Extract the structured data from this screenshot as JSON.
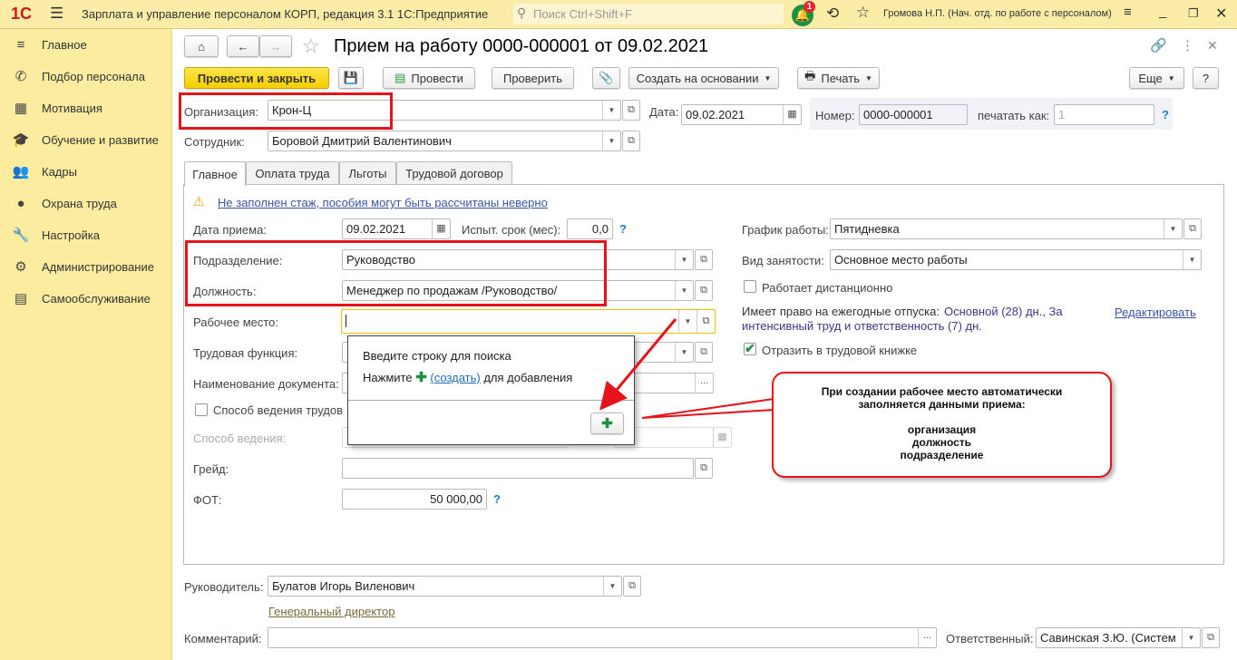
{
  "app": {
    "logo": "1С",
    "title": "Зарплата и управление персоналом КОРП, редакция 3.1 1С:Предприятие",
    "search_placeholder": "Поиск Ctrl+Shift+F",
    "notifications_count": "1",
    "user": "Громова Н.П. (Нач. отд. по работе с персоналом)"
  },
  "sidebar": {
    "items": [
      {
        "label": "Главное",
        "icon": "menu-icon"
      },
      {
        "label": "Подбор персонала",
        "icon": "phone-icon"
      },
      {
        "label": "Мотивация",
        "icon": "gift-icon"
      },
      {
        "label": "Обучение и развитие",
        "icon": "graduation-cap-icon"
      },
      {
        "label": "Кадры",
        "icon": "users-icon"
      },
      {
        "label": "Охрана труда",
        "icon": "helmet-icon"
      },
      {
        "label": "Настройка",
        "icon": "wrench-icon"
      },
      {
        "label": "Администрирование",
        "icon": "gear-icon"
      },
      {
        "label": "Самообслуживание",
        "icon": "id-card-icon"
      }
    ]
  },
  "doc": {
    "title": "Прием на работу 0000-000001 от 09.02.2021"
  },
  "toolbar": {
    "post_close": "Провести и закрыть",
    "post": "Провести",
    "check": "Проверить",
    "create_based": "Создать на основании",
    "print": "Печать",
    "more": "Еще",
    "help": "?"
  },
  "header": {
    "org_label": "Организация:",
    "org_value": "Крон-Ц",
    "date_label": "Дата:",
    "date_value": "09.02.2021",
    "number_label": "Номер:",
    "number_value": "0000-000001",
    "print_as_label": "печатать как:",
    "print_as_value": "1",
    "employee_label": "Сотрудник:",
    "employee_value": "Боровой Дмитрий Валентинович"
  },
  "tabs": [
    "Главное",
    "Оплата труда",
    "Льготы",
    "Трудовой договор"
  ],
  "main": {
    "warning": "Не заполнен стаж, пособия могут быть рассчитаны неверно",
    "hire_date_label": "Дата приема:",
    "hire_date_value": "09.02.2021",
    "probation_label": "Испыт. срок (мес):",
    "probation_value": "0,0",
    "department_label": "Подразделение:",
    "department_value": "Руководство",
    "position_label": "Должность:",
    "position_value": "Менеджер по продажам /Руководство/",
    "workplace_label": "Рабочее место:",
    "workplace_value": "",
    "labor_function_label": "Трудовая функция:",
    "doc_name_label": "Наименование документа:",
    "method_checkbox_label": "Способ ведения трудов",
    "method_label": "Способ ведения:",
    "grade_label": "Грейд:",
    "grade_value": "",
    "fot_label": "ФОТ:",
    "fot_value": "50 000,00",
    "schedule_label": "График работы:",
    "schedule_value": "Пятидневка",
    "employment_label": "Вид занятости:",
    "employment_value": "Основное место работы",
    "remote_label": "Работает дистанционно",
    "remote_checked": false,
    "vacation_label": "Имеет право на ежегодные отпуска:",
    "vacation_value1": "Основной (28) дн., За",
    "vacation_value2": "интенсивный труд и ответственность (7) дн.",
    "edit_link": "Редактировать",
    "workbook_label": "Отразить в трудовой книжке",
    "workbook_checked": true
  },
  "popup": {
    "line1": "Введите строку для поиска",
    "line2_pre": "Нажмите",
    "line2_link": "(создать)",
    "line2_post": "для добавления"
  },
  "callout": {
    "line1": "При создании рабочее место автоматически",
    "line2": "заполняется данными приема:",
    "item1": "организация",
    "item2": "должность",
    "item3": "подразделение"
  },
  "footer": {
    "manager_label": "Руководитель:",
    "manager_value": "Булатов Игорь Виленович",
    "manager_position": "Генеральный директор",
    "comment_label": "Комментарий:",
    "comment_value": "",
    "responsible_label": "Ответственный:",
    "responsible_value": "Савинская З.Ю. (Систем"
  },
  "colors": {
    "accent_yellow": "#f4cf00",
    "highlight_red": "#e6141a",
    "sidebar_bg": "#fbeca0",
    "link": "#3a55a8"
  }
}
